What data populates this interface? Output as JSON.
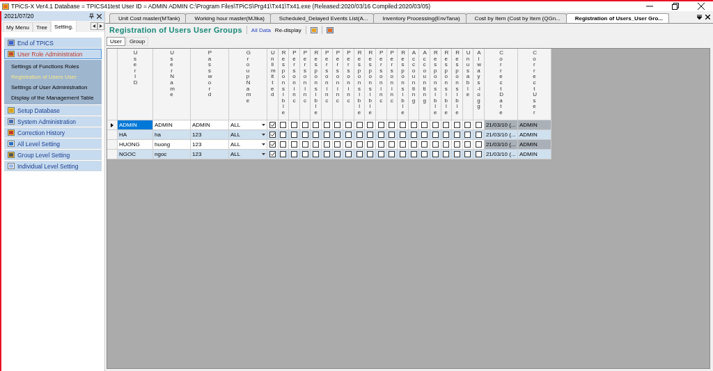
{
  "window": {
    "title": "TPiCS-X Ver4.1  Database = TPICS41test   User ID = ADMIN  ADMIN    C:\\Program Files\\TPiCS\\Prg41\\Tx41\\Tx41.exe (Released:2020/03/16 Compiled:2020/03/05)"
  },
  "sidebar": {
    "date": "2021/07/20",
    "tabs": [
      {
        "label": "My Menu",
        "selected": false
      },
      {
        "label": "Tree",
        "selected": false
      },
      {
        "label": "Setting.",
        "selected": true
      }
    ],
    "menu": [
      {
        "label": "End of TPICS",
        "expanded": false
      },
      {
        "label": "User  Role Administration",
        "expanded": true,
        "children": [
          {
            "label": "Settings of Functions  Roles",
            "selected": false
          },
          {
            "label": "Registration of Users  User",
            "selected": true
          },
          {
            "label": "Settings of User Administration",
            "selected": false
          },
          {
            "label": "Display of the Management Table",
            "selected": false
          }
        ]
      },
      {
        "label": "Setup Database",
        "expanded": false
      },
      {
        "label": "System Administration",
        "expanded": false
      },
      {
        "label": "Correction History",
        "expanded": false
      },
      {
        "label": "All Level Setting",
        "expanded": false
      },
      {
        "label": "Group Level Setting",
        "expanded": false
      },
      {
        "label": "Individual Level Setting",
        "expanded": false
      }
    ]
  },
  "doc_tabs": [
    {
      "label": "Unit Cost master(MTank)",
      "selected": false
    },
    {
      "label": "Working hour master(MJika)",
      "selected": false
    },
    {
      "label": "Scheduled_Delayed Events List(A...",
      "selected": false
    },
    {
      "label": "Inventory Processing(EnvTana)",
      "selected": false
    },
    {
      "label": "Cost by Item (Cost by Item (QGn...",
      "selected": false
    },
    {
      "label": "Registration of Users_User Gro...",
      "selected": true
    }
  ],
  "toolbar": {
    "title": "Registration of Users  User Groups",
    "buttons": [
      "All Data",
      "Re-display"
    ]
  },
  "sub_tabs": [
    {
      "label": "User",
      "selected": true
    },
    {
      "label": "Group",
      "selected": false
    }
  ],
  "table": {
    "columns": [
      "User ID",
      "User Name",
      "Password",
      "Group Name",
      "Unlimitted",
      "Responsible",
      "Person in c",
      "Person in c",
      "Responsible",
      "Person in c",
      "Person in c",
      "Person in c",
      "Responsible",
      "Responsible",
      "Person in c",
      "Person in c",
      "Responsible",
      "Accounting",
      "Accounting",
      "Responsible",
      "Responsible",
      "Responsible",
      "Unusable",
      "Always-logg",
      "CorrectDate",
      "CorrectUser"
    ],
    "rows": [
      {
        "selected": true,
        "user_id": "ADMIN",
        "user_name": "ADMIN",
        "password": "ADMIN",
        "group_name": "ALL",
        "checks": [
          true,
          false,
          false,
          false,
          false,
          false,
          false,
          false,
          false,
          false,
          false,
          false,
          false,
          false,
          false,
          false,
          false,
          false,
          false,
          false
        ],
        "correct_date": "21/03/10 (...",
        "correct_user": "ADMIN"
      },
      {
        "selected": false,
        "user_id": "HA",
        "user_name": "ha",
        "password": "123",
        "group_name": "ALL",
        "checks": [
          true,
          false,
          false,
          false,
          false,
          false,
          false,
          false,
          false,
          false,
          false,
          false,
          false,
          false,
          false,
          false,
          false,
          false,
          false,
          false
        ],
        "correct_date": "21/03/10 (...",
        "correct_user": "ADMIN"
      },
      {
        "selected": false,
        "user_id": "HUONG",
        "user_name": "huong",
        "password": "123",
        "group_name": "ALL",
        "checks": [
          true,
          false,
          false,
          false,
          false,
          false,
          false,
          false,
          false,
          false,
          false,
          false,
          false,
          false,
          false,
          false,
          false,
          false,
          false,
          false
        ],
        "correct_date": "21/03/10 (...",
        "correct_user": "ADMIN"
      },
      {
        "selected": false,
        "user_id": "NGOC",
        "user_name": "ngoc",
        "password": "123",
        "group_name": "ALL",
        "checks": [
          true,
          false,
          false,
          false,
          false,
          false,
          false,
          false,
          false,
          false,
          false,
          false,
          false,
          false,
          false,
          false,
          false,
          false,
          false,
          false
        ],
        "correct_date": "21/03/10 (...",
        "correct_user": "ADMIN"
      }
    ]
  }
}
